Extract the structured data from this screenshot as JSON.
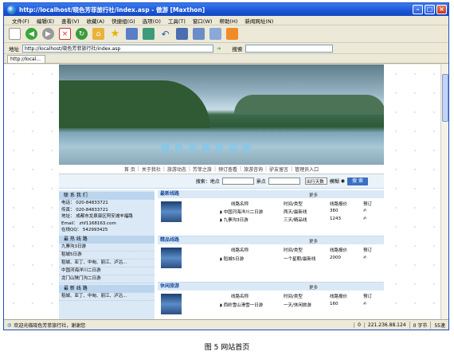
{
  "window": {
    "title": "http://localhost/晓色芳菲旅行社/index.asp - 傲游 [Maxthon]"
  },
  "menu": [
    "文件(F)",
    "编辑(E)",
    "查看(V)",
    "收藏(A)",
    "快捷组(G)",
    "选项(O)",
    "工具(T)",
    "窗口(W)",
    "帮助(H)",
    "新闻网址(N)"
  ],
  "address": {
    "label": "地址",
    "url": "http://localhost/晓色芳菲旅行社/index.asp",
    "search_label": "搜索"
  },
  "tab": {
    "label": "http://local..."
  },
  "site": {
    "slogan": "晓色芳菲欢迎您",
    "nav": [
      "首 页",
      "关于我社",
      "旅游动态",
      "芳菲之旅",
      "预订查看",
      "旅游咨询",
      "驴友留言",
      "管理员入口"
    ],
    "search": {
      "label": "搜索：",
      "place_label": "地点",
      "spot_label": "景点",
      "days_select": "出行天数",
      "fuzzy_label": "模糊",
      "button": "搜 索"
    }
  },
  "contact": {
    "title": "联 系 我 们",
    "lines": [
      "电话： 020-84833721",
      "传真： 020-84833721",
      "地址： 成都市龙泉驿区阿安滩丰福路",
      "Email： zhf1168163.com",
      "在线QQ： 542993425"
    ]
  },
  "top_routes": {
    "title": "最 热 线 路",
    "items": [
      "九寨沟3日游",
      "稻城5日游",
      "稻城、亚丁、中甸、丽江、泸沽…",
      "中国河海洋川二日游",
      "龙门山陕门沟二日游"
    ]
  },
  "new_routes_left": {
    "title": "最 新 线 路",
    "items": [
      "稻城、亚丁、中甸、丽江、泸沽…"
    ]
  },
  "columns": {
    "name": "线路名称",
    "time": "时间/类型",
    "price": "线路报价",
    "book": "预订"
  },
  "sections": [
    {
      "title": "最新线路",
      "more": "更多",
      "rows": [
        {
          "name": "中国河海洋川二日游",
          "time": "两天/最新线",
          "price": "360"
        },
        {
          "name": "九寨沟3日游",
          "time": "三天/精品线",
          "price": "1243"
        }
      ]
    },
    {
      "title": "精品线路",
      "more": "更多",
      "rows": [
        {
          "name": "稻城5日游",
          "time": "一个星期/最新线",
          "price": "2000"
        }
      ]
    },
    {
      "title": "休闲旅游",
      "more": "更多",
      "rows": [
        {
          "name": "西岭雪山滑雪一日游",
          "time": "一天/休闲旅游",
          "price": "160"
        }
      ]
    }
  ],
  "status": {
    "text": "欢迎光临晓色芳菲旅行社，谢谢您",
    "count": "0",
    "ip": "221.236.88.124",
    "bytes": "0 字节",
    "speed": "55速"
  },
  "caption": "图 5 网站首页"
}
